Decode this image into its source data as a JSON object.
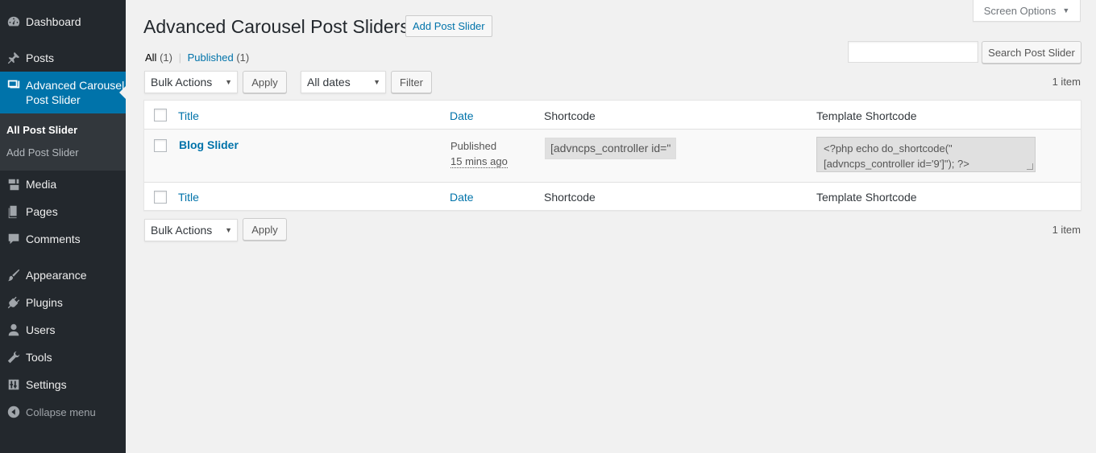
{
  "sidebar": {
    "items": [
      {
        "label": "Dashboard",
        "icon": "dashboard-icon"
      },
      {
        "label": "Posts",
        "icon": "pin-icon"
      },
      {
        "label": "Advanced Carousel Post Slider",
        "icon": "slides-icon"
      },
      {
        "label": "Media",
        "icon": "media-icon"
      },
      {
        "label": "Pages",
        "icon": "pages-icon"
      },
      {
        "label": "Comments",
        "icon": "comments-icon"
      },
      {
        "label": "Appearance",
        "icon": "brush-icon"
      },
      {
        "label": "Plugins",
        "icon": "plugin-icon"
      },
      {
        "label": "Users",
        "icon": "user-icon"
      },
      {
        "label": "Tools",
        "icon": "wrench-icon"
      },
      {
        "label": "Settings",
        "icon": "settings-icon"
      }
    ],
    "current_line1": "Advanced Carousel",
    "current_line2": "Post Slider",
    "submenu": [
      "All Post Slider",
      "Add Post Slider"
    ],
    "collapse_label": "Collapse menu"
  },
  "header": {
    "title": "Advanced Carousel Post Sliders",
    "add_new_label": "Add Post Slider",
    "screen_options_label": "Screen Options"
  },
  "views": {
    "all_label": "All",
    "all_count": "(1)",
    "separator": "|",
    "published_label": "Published",
    "published_count": "(1)"
  },
  "search": {
    "value": "",
    "button_label": "Search Post Slider"
  },
  "tablenav": {
    "bulk_actions": "Bulk Actions",
    "apply_label": "Apply",
    "dates_filter": "All dates",
    "filter_label": "Filter",
    "items_count": "1 item"
  },
  "table": {
    "columns": [
      "Title",
      "Date",
      "Shortcode",
      "Template Shortcode"
    ],
    "rows": [
      {
        "title": "Blog Slider",
        "status": "Published",
        "date": "15 mins ago",
        "shortcode": "[advncps_controller id=\"",
        "template_line1": "<?php echo do_shortcode(\"",
        "template_line2": "[advncps_controller id='9']\"); ?>"
      }
    ]
  },
  "colors": {
    "sidebar_bg": "#23282d",
    "sidebar_active": "#0073aa",
    "link": "#0073aa",
    "page_bg": "#f1f1f1"
  }
}
